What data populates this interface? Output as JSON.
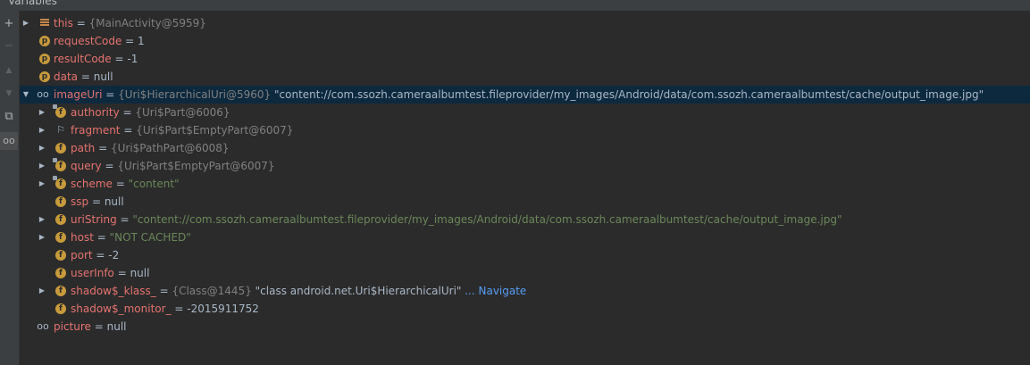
{
  "panel": {
    "title": "Variables"
  },
  "toolbar": {
    "add": "+",
    "remove": "−",
    "up": "▲",
    "down": "▼",
    "copy": "⧉",
    "watch": "oo"
  },
  "icons": {
    "expanded": "▼",
    "collapsed": "▶",
    "field": "f",
    "param": "p",
    "watch": "oo",
    "flag": "⚐"
  },
  "vars": [
    {
      "name": "this",
      "eq": " = ",
      "type": "{MainActivity@5959}"
    },
    {
      "name": "requestCode",
      "eq": " = ",
      "value": "1"
    },
    {
      "name": "resultCode",
      "eq": " = ",
      "value": "-1"
    },
    {
      "name": "data",
      "eq": " = ",
      "value": "null"
    },
    {
      "name": "imageUri",
      "eq": " = ",
      "type": "{Uri$HierarchicalUri@5960}",
      "value": " \"content://com.ssozh.cameraalbumtest.fileprovider/my_images/Android/data/com.ssozh.cameraalbumtest/cache/output_image.jpg\""
    },
    {
      "name": "authority",
      "eq": " = ",
      "type": "{Uri$Part@6006}"
    },
    {
      "name": "fragment",
      "eq": " = ",
      "type": "{Uri$Part$EmptyPart@6007}"
    },
    {
      "name": "path",
      "eq": " = ",
      "type": "{Uri$PathPart@6008}"
    },
    {
      "name": "query",
      "eq": " = ",
      "type": "{Uri$Part$EmptyPart@6007}"
    },
    {
      "name": "scheme",
      "eq": " = ",
      "str": "\"content\""
    },
    {
      "name": "ssp",
      "eq": " = ",
      "value": "null"
    },
    {
      "name": "uriString",
      "eq": " = ",
      "str": "\"content://com.ssozh.cameraalbumtest.fileprovider/my_images/Android/data/com.ssozh.cameraalbumtest/cache/output_image.jpg\""
    },
    {
      "name": "host",
      "eq": " = ",
      "str": "\"NOT CACHED\""
    },
    {
      "name": "port",
      "eq": " = ",
      "value": "-2"
    },
    {
      "name": "userInfo",
      "eq": " = ",
      "value": "null"
    },
    {
      "name": "shadow$_klass_",
      "eq": " = ",
      "type": "{Class@1445}",
      "value": " \"class android.net.Uri$HierarchicalUri\"",
      "link": " ... Navigate"
    },
    {
      "name": "shadow$_monitor_",
      "eq": " = ",
      "value": "-2015911752"
    },
    {
      "name": "picture",
      "eq": " = ",
      "value": "null"
    }
  ]
}
